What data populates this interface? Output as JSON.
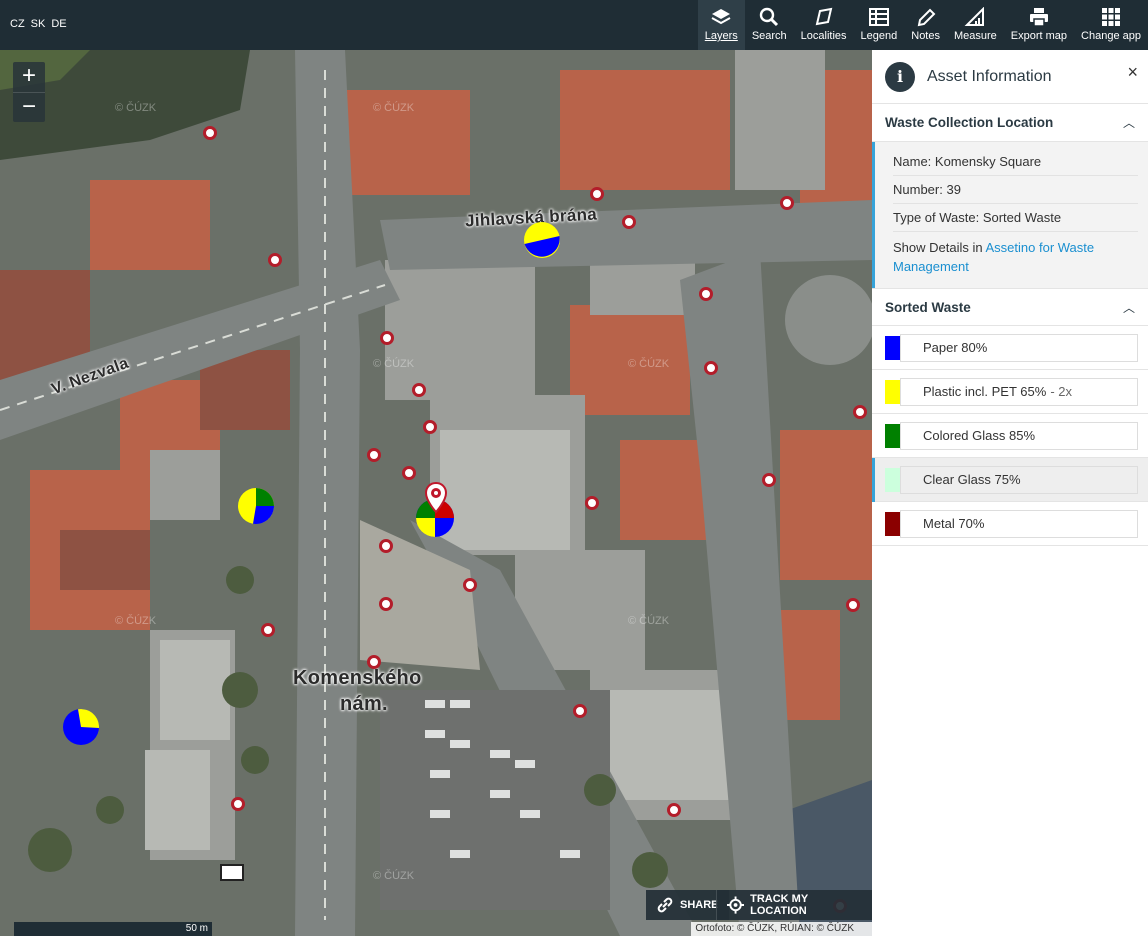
{
  "languages": [
    "CZ",
    "SK",
    "DE"
  ],
  "toolbar": {
    "items": [
      {
        "label": "Layers",
        "icon": "layers-icon",
        "active": true
      },
      {
        "label": "Search",
        "icon": "search-icon"
      },
      {
        "label": "Localities",
        "icon": "localities-icon"
      },
      {
        "label": "Legend",
        "icon": "legend-icon"
      },
      {
        "label": "Notes",
        "icon": "pencil-icon"
      },
      {
        "label": "Measure",
        "icon": "ruler-icon"
      },
      {
        "label": "Export map",
        "icon": "printer-icon"
      },
      {
        "label": "Change app",
        "icon": "grid-icon"
      }
    ]
  },
  "map": {
    "zoom_in": "+",
    "zoom_out": "−",
    "place_labels": [
      "Jihlavská brána",
      "V. Nezvala",
      "Komenského",
      "nám."
    ],
    "watermark": "© ČÚZK",
    "share_label": "SHARE",
    "track_label": "TRACK MY LOCATION",
    "scale_label": "50 m",
    "attribution": "Ortofoto: © ČÚZK, RÚIAN: © ČÚZK"
  },
  "panel": {
    "title": "Asset Information",
    "close": "×",
    "section1_title": "Waste Collection Location",
    "details": {
      "name": "Name: Komensky Square",
      "number": "Number: 39",
      "type": "Type of Waste: Sorted Waste",
      "show_details_prefix": "Show Details in ",
      "show_details_link": "Assetino for Waste Management"
    },
    "section2_title": "Sorted Waste",
    "waste": [
      {
        "label": "Paper 80%",
        "color": "#0000ff",
        "extra": ""
      },
      {
        "label": "Plastic incl. PET 65%",
        "color": "#ffff00",
        "extra": "- 2x"
      },
      {
        "label": "Colored Glass 85%",
        "color": "#008000",
        "extra": ""
      },
      {
        "label": "Clear Glass 75%",
        "color": "#ccffdd",
        "extra": ""
      },
      {
        "label": "Metal 70%",
        "color": "#8b0000",
        "extra": ""
      }
    ]
  },
  "colors": {
    "topbar": "#1f2d35",
    "accent": "#36a3d9",
    "marker_ring": "#b31d2a",
    "paper": "#0000ff",
    "plastic": "#ffff00",
    "colored_glass": "#008000"
  }
}
